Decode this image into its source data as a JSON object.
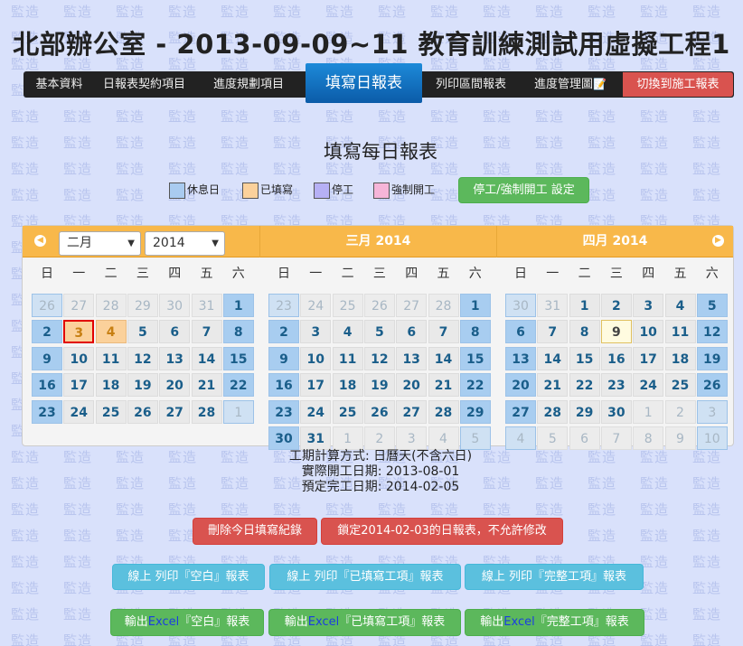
{
  "watermark_text": "監造",
  "site_title": "北部辦公室 - 2013-09-09~11 教育訓練測試用虛擬工程1",
  "nav": {
    "items": [
      "基本資料",
      "日報表契約項目",
      "進度規劃項目"
    ],
    "active": "填寫日報表",
    "items_right": [
      "列印區間報表",
      "進度管理圖"
    ],
    "chart_icon": "📝",
    "danger": "切換到施工報表"
  },
  "page_title": "填寫每日報表",
  "legend": {
    "holiday": "休息日",
    "filled": "已填寫",
    "stop": "停工",
    "forced": "強制開工",
    "button": "停工/強制開工 設定",
    "colors": {
      "holiday": "#a9cbf0",
      "filled": "#fbd19b",
      "stop": "#b6b0f5",
      "forced": "#f6b5d8"
    }
  },
  "calendar": {
    "month_select": "二月",
    "year_select": "2014",
    "prev_icon": "◀",
    "next_icon": "▶",
    "arrow": "▼",
    "weekdays": [
      "日",
      "一",
      "二",
      "三",
      "四",
      "五",
      "六"
    ],
    "months": [
      {
        "title": "",
        "rows": [
          [
            "26",
            "27",
            "28",
            "29",
            "30",
            "31",
            "1"
          ],
          [
            "2",
            "3",
            "4",
            "5",
            "6",
            "7",
            "8"
          ],
          [
            "9",
            "10",
            "11",
            "12",
            "13",
            "14",
            "15"
          ],
          [
            "16",
            "17",
            "18",
            "19",
            "20",
            "21",
            "22"
          ],
          [
            "23",
            "24",
            "25",
            "26",
            "27",
            "28",
            "1"
          ]
        ]
      },
      {
        "title": "三月 2014",
        "rows": [
          [
            "23",
            "24",
            "25",
            "26",
            "27",
            "28",
            "1"
          ],
          [
            "2",
            "3",
            "4",
            "5",
            "6",
            "7",
            "8"
          ],
          [
            "9",
            "10",
            "11",
            "12",
            "13",
            "14",
            "15"
          ],
          [
            "16",
            "17",
            "18",
            "19",
            "20",
            "21",
            "22"
          ],
          [
            "23",
            "24",
            "25",
            "26",
            "27",
            "28",
            "29"
          ],
          [
            "30",
            "31",
            "1",
            "2",
            "3",
            "4",
            "5"
          ]
        ]
      },
      {
        "title": "四月 2014",
        "rows": [
          [
            "30",
            "31",
            "1",
            "2",
            "3",
            "4",
            "5"
          ],
          [
            "6",
            "7",
            "8",
            "9",
            "10",
            "11",
            "12"
          ],
          [
            "13",
            "14",
            "15",
            "16",
            "17",
            "18",
            "19"
          ],
          [
            "20",
            "21",
            "22",
            "23",
            "24",
            "25",
            "26"
          ],
          [
            "27",
            "28",
            "29",
            "30",
            "1",
            "2",
            "3"
          ],
          [
            "4",
            "5",
            "6",
            "7",
            "8",
            "9",
            "10"
          ]
        ]
      }
    ]
  },
  "info": {
    "calc_method": "工期計算方式: 日曆天(不含六日)",
    "actual_start": "實際開工日期: 2013-08-01",
    "planned_end": "預定完工日期: 2014-02-05"
  },
  "actions": {
    "delete_today": "刪除今日填寫紀錄",
    "lock": "鎖定2014-02-03的日報表，不允許修改",
    "print_blank": "線上 列印『空白』報表",
    "print_filled": "線上 列印『已填寫工項』報表",
    "print_complete": "線上 列印『完整工項』報表",
    "export_prefix": "輸出",
    "export_excel": "Excel",
    "export_blank_suffix": "『空白』報表",
    "export_filled_suffix": "『已填寫工項』報表",
    "export_complete_suffix": "『完整工項』報表"
  }
}
